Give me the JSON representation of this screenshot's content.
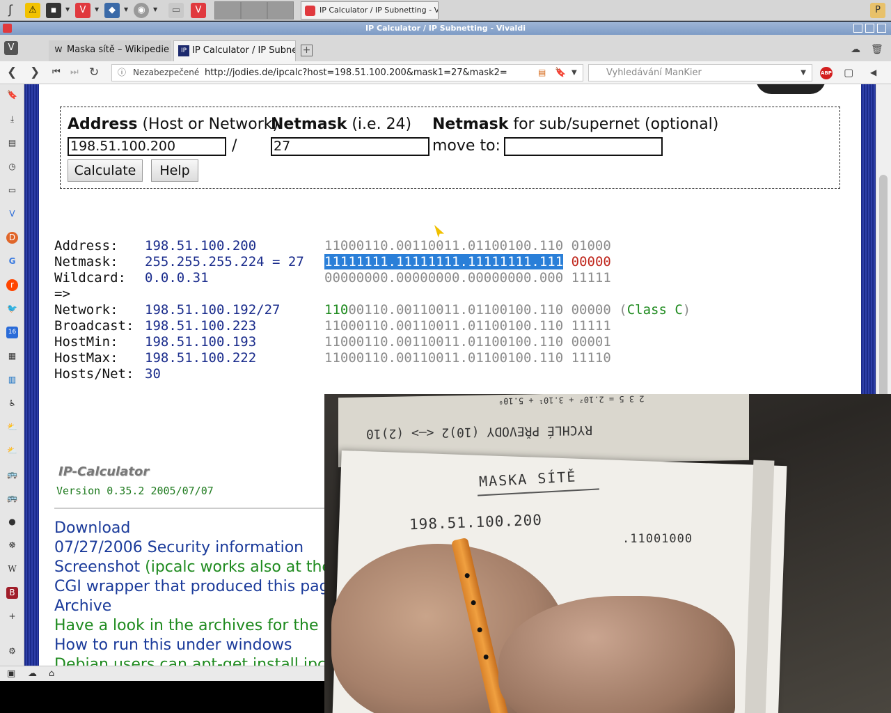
{
  "taskbar": {
    "task_title": "IP Calculator / IP Subnetting - Vi..."
  },
  "window": {
    "title": "IP Calculator / IP Subnetting - Vivaldi"
  },
  "tabs": [
    {
      "label": "Maska sítě – Wikipedie",
      "favicon": "W"
    },
    {
      "label": "IP Calculator / IP Subnet",
      "favicon": "IP"
    }
  ],
  "address_bar": {
    "security_label": "Nezabezpečené",
    "url": "http://jodies.de/ipcalc?host=198.51.100.200&mask1=27&mask2="
  },
  "search": {
    "placeholder": "Vyhledávání ManKier"
  },
  "form": {
    "address_label_bold": "Address",
    "address_label_rest": " (Host or Network)",
    "netmask_label_bold": "Netmask",
    "netmask_label_rest": " (i.e. 24)",
    "subnet_label_bold": "Netmask",
    "subnet_label_rest": " for sub/supernet (optional)",
    "address_value": "198.51.100.200",
    "slash": "/",
    "netmask_value": "27",
    "move_to_label": "move to:",
    "move_to_value": "",
    "calculate_label": "Calculate",
    "help_label": "Help"
  },
  "results": [
    {
      "label": "Address:",
      "value": "198.51.100.200"
    },
    {
      "label": "Netmask:",
      "value": "255.255.255.224 = 27"
    },
    {
      "label": "Wildcard:",
      "value": "0.0.0.31"
    },
    {
      "label": "=>",
      "value": ""
    },
    {
      "label": "Network:",
      "value": "198.51.100.192/27"
    },
    {
      "label": "Broadcast:",
      "value": "198.51.100.223"
    },
    {
      "label": "HostMin:",
      "value": "198.51.100.193"
    },
    {
      "label": "HostMax:",
      "value": "198.51.100.222"
    },
    {
      "label": "Hosts/Net:",
      "value": "30"
    }
  ],
  "bits": {
    "address": "11000110.00110011.01100100.110 01000",
    "netmask_hl": "11111111.11111111.11111111.111",
    "netmask_red": "00000",
    "wildcard": "00000000.00000000.00000000.000 11111",
    "network_grn": "110",
    "network_rest": "00110.00110011.01100100.110 00000 (",
    "network_class": "Class C",
    "network_close": ")",
    "broadcast": "11000110.00110011.01100100.110 11111",
    "hostmin": "11000110.00110011.01100100.110 00001",
    "hostmax": "11000110.00110011.01100100.110 11110"
  },
  "footer": {
    "logo_text": "IP-Calculator",
    "version": "Version 0.35.2 2005/07/07"
  },
  "links": [
    {
      "text": "Download",
      "color": "blue"
    },
    {
      "text": "07/27/2006 Security information",
      "color": "blue"
    },
    {
      "text": "Screenshot (ipcalc works also at the",
      "color": "mixed"
    },
    {
      "text": "CGI wrapper that produced this page",
      "color": "blue"
    },
    {
      "text": "Archive",
      "color": "blue"
    },
    {
      "text": "Have a look in the archives for the n",
      "color": "green"
    },
    {
      "text": "How to run this under windows",
      "color": "blue"
    },
    {
      "text": "Debian users can apt-get install ipca",
      "color": "green"
    }
  ],
  "video": {
    "top_text": "RYCHLÉ PŘEVODY (10)2 <—> (2)10",
    "formula": "2 3 5 = 2.10² + 3.10¹ + 5.10⁰",
    "heading": "MASKA SÍTĚ",
    "ip": "198.51.100.200",
    "binary": ".11001000"
  },
  "colors": {
    "accent": "#e0393e",
    "link_blue": "#1a3a9a",
    "link_green": "#1e8a1e",
    "highlight": "#2a7fd8",
    "value_blue": "#1a2c8c"
  }
}
